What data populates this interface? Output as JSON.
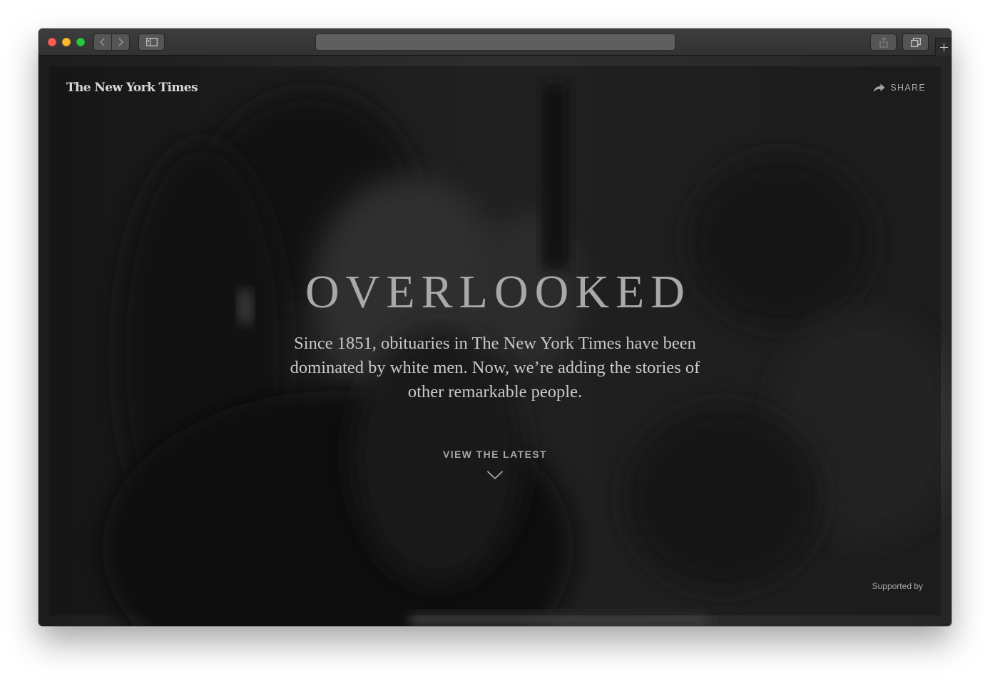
{
  "browser": {
    "address_url": "",
    "icons": [
      "back-icon",
      "forward-icon",
      "sidebar-icon",
      "share-icon",
      "tabs-icon",
      "plus-icon"
    ]
  },
  "page": {
    "logo_text": "The New York Times",
    "share_label": "SHARE",
    "title": "OVERLOOKED",
    "summary": "Since 1851, obituaries in The New York Times have been dominated by white men. Now, we’re adding the stories of other remarkable people.",
    "cta_label": "VIEW THE LATEST",
    "supported_by": "Supported by"
  },
  "colors": {
    "traffic_close": "#fc5f57",
    "traffic_minimize": "#fdbc2e",
    "traffic_maximize": "#29c840",
    "chrome": "#363636",
    "hero_overlay": "#0e0e0e"
  }
}
